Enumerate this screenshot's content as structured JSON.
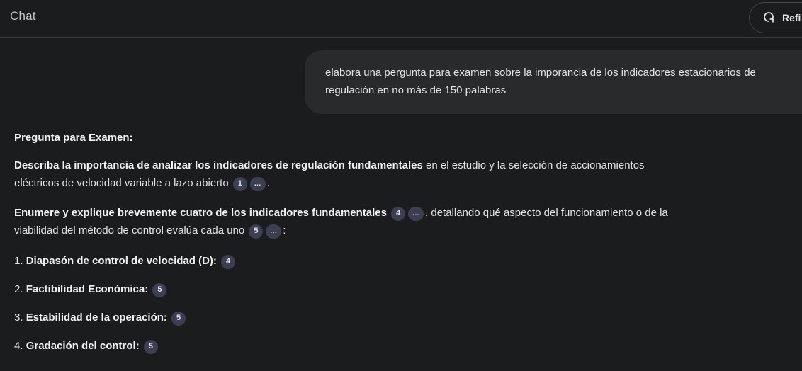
{
  "header": {
    "title": "Chat",
    "refresh_label": "Refi"
  },
  "user_message": {
    "line1": "elabora una pergunta para examen sobre la imporancia de los indicadores estacionarios de",
    "line2": "regulación en no más de 150 palabras"
  },
  "answer": {
    "heading": "Pregunta para Examen:",
    "p1_bold": "Describa la importancia de analizar los indicadores de regulación fundamentales",
    "p1_rest": " en el estudio y la selección de accionamientos",
    "p1_line2": "eléctricos de velocidad variable a lazo abierto",
    "p1_cite1": "1",
    "p1_cite_more": "...",
    "p1_end": ".",
    "p2_bold": "Enumere y explique brevemente cuatro de los indicadores fundamentales",
    "p2_cite1": "4",
    "p2_cite_more1": "...",
    "p2_rest": ", detallando qué aspecto del funcionamiento o de la",
    "p2_line2": "viabilidad del método de control evalúa cada uno",
    "p2_cite2": "5",
    "p2_cite_more2": "...",
    "p2_end": ":",
    "items": [
      {
        "num": "1. ",
        "label": "Diapasón de control de velocidad (D):",
        "cite": "4"
      },
      {
        "num": "2. ",
        "label": "Factibilidad Económica:",
        "cite": "5"
      },
      {
        "num": "3. ",
        "label": "Estabilidad de la operación:",
        "cite": "5"
      },
      {
        "num": "4. ",
        "label": "Gradación del control:",
        "cite": "5"
      }
    ]
  },
  "colors": {
    "background": "#1b1c1d",
    "bubble": "#282a2c",
    "citation_chip": "#3c3f52",
    "text": "#e3e3e3"
  },
  "icons": {
    "refresh": "refresh-icon"
  }
}
